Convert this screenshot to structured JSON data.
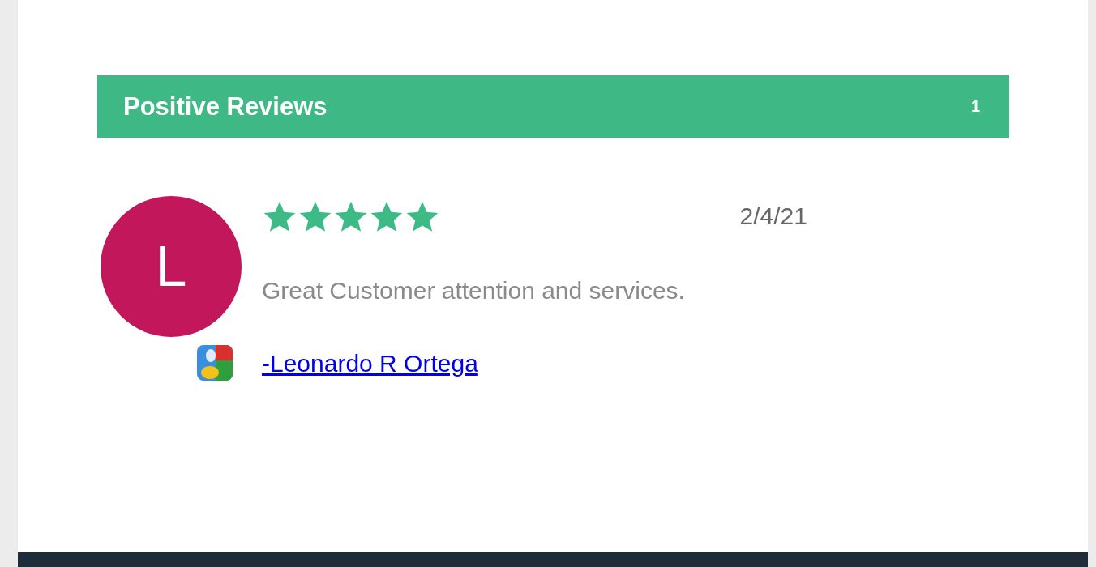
{
  "section_header": {
    "title": "Positive Reviews",
    "count": "1"
  },
  "reviews": [
    {
      "initial": "L",
      "stars": 5,
      "date": "2/4/21",
      "text": "Great Customer attention and services.",
      "author": "-Leonardo R Ortega"
    }
  ]
}
